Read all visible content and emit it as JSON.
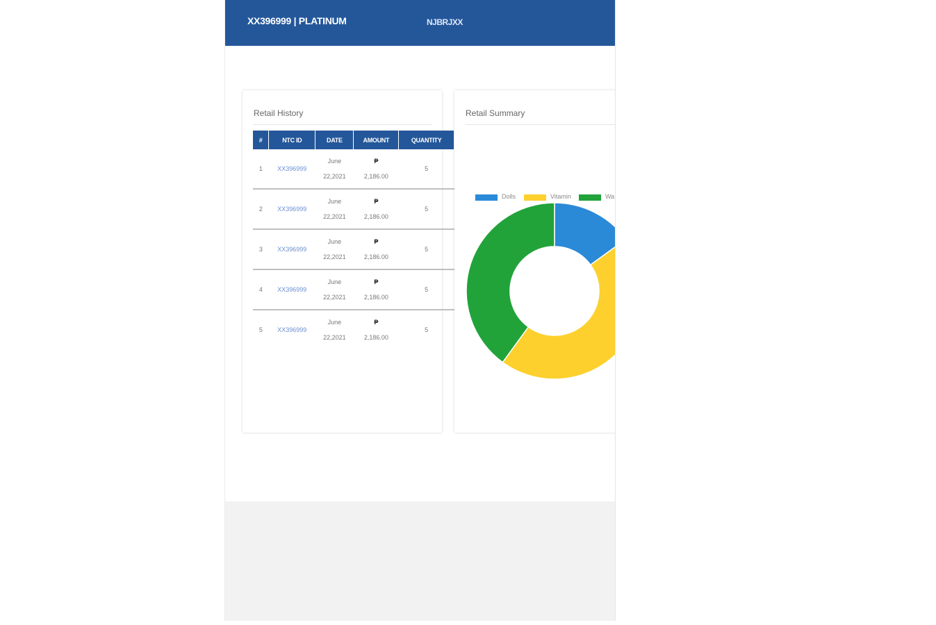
{
  "header": {
    "title": "XX396999 | PLATINUM",
    "logo": "NJBRJXX"
  },
  "history": {
    "title": "Retail History",
    "columns": [
      "#",
      "NTC ID",
      "DATE",
      "AMOUNT",
      "QUANTITY"
    ],
    "rows": [
      {
        "num": "1",
        "ntc_id": "XX396999",
        "date_line1": "June",
        "date_line2": "22,2021",
        "currency": "₱",
        "amount": "2,186.00",
        "quantity": "5"
      },
      {
        "num": "2",
        "ntc_id": "XX396999",
        "date_line1": "June",
        "date_line2": "22,2021",
        "currency": "₱",
        "amount": "2,186.00",
        "quantity": "5"
      },
      {
        "num": "3",
        "ntc_id": "XX396999",
        "date_line1": "June",
        "date_line2": "22,2021",
        "currency": "₱",
        "amount": "2,186.00",
        "quantity": "5"
      },
      {
        "num": "4",
        "ntc_id": "XX396999",
        "date_line1": "June",
        "date_line2": "22,2021",
        "currency": "₱",
        "amount": "2,186.00",
        "quantity": "5"
      },
      {
        "num": "5",
        "ntc_id": "XX396999",
        "date_line1": "June",
        "date_line2": "22,2021",
        "currency": "₱",
        "amount": "2,186.00",
        "quantity": "5"
      }
    ]
  },
  "summary": {
    "title": "Retail Summary",
    "chart_data": {
      "type": "pie",
      "title": "",
      "categories": [
        "Dolls",
        "Vitamin",
        "Wa"
      ],
      "values": [
        15,
        45,
        40
      ],
      "colors": [
        "#2a8ad8",
        "#fdd02d",
        "#21a33a"
      ],
      "legend_position": "top"
    }
  }
}
